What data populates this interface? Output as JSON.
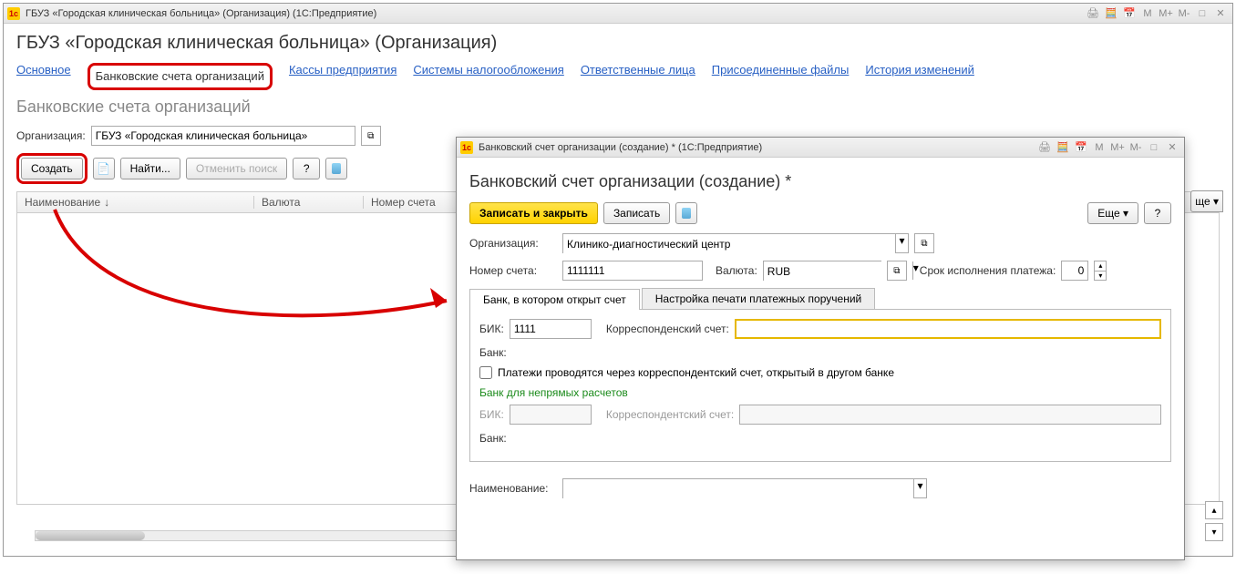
{
  "main_window": {
    "title": "ГБУЗ «Городская клиническая больница» (Организация)  (1С:Предприятие)",
    "page_title": "ГБУЗ «Городская клиническая больница» (Организация)",
    "nav": [
      "Основное",
      "Банковские счета организаций",
      "Кассы предприятия",
      "Системы налогообложения",
      "Ответственные лица",
      "Присоединенные файлы",
      "История изменений"
    ],
    "active_nav_index": 1,
    "section_title": "Банковские счета организаций",
    "org_label": "Организация:",
    "org_value": "ГБУЗ «Городская клиническая больница»",
    "create_btn": "Создать",
    "find_btn": "Найти...",
    "cancel_search_btn": "Отменить поиск",
    "help_btn": "?",
    "more_btn": "ще ▾",
    "columns": [
      "Наименование",
      "Валюта",
      "Номер счета"
    ]
  },
  "dialog": {
    "title": "Банковский счет организации (создание) *  (1С:Предприятие)",
    "page_title": "Банковский счет организации (создание) *",
    "save_close": "Записать и закрыть",
    "save": "Записать",
    "more": "Еще ▾",
    "help": "?",
    "org_label": "Организация:",
    "org_value": "Клинико-диагностический центр",
    "accnum_label": "Номер счета:",
    "accnum_value": "1111111",
    "currency_label": "Валюта:",
    "currency_value": "RUB",
    "term_label": "Срок исполнения платежа:",
    "term_value": "0",
    "tabs": [
      "Банк, в котором открыт счет",
      "Настройка печати платежных поручений"
    ],
    "active_tab_index": 0,
    "bik_label": "БИК:",
    "bik_value": "1111",
    "corr_label": "Корреспонденский счет:",
    "bank_label": "Банк:",
    "chk_label": "Платежи проводятся через корреспондентский счет, открытый в другом банке",
    "indirect_title": "Банк для непрямых расчетов",
    "bik2_label": "БИК:",
    "corr2_label": "Корреспондентский счет:",
    "bank2_label": "Банк:",
    "name_label": "Наименование:"
  },
  "tb_letters": [
    "M",
    "M+",
    "M-"
  ]
}
